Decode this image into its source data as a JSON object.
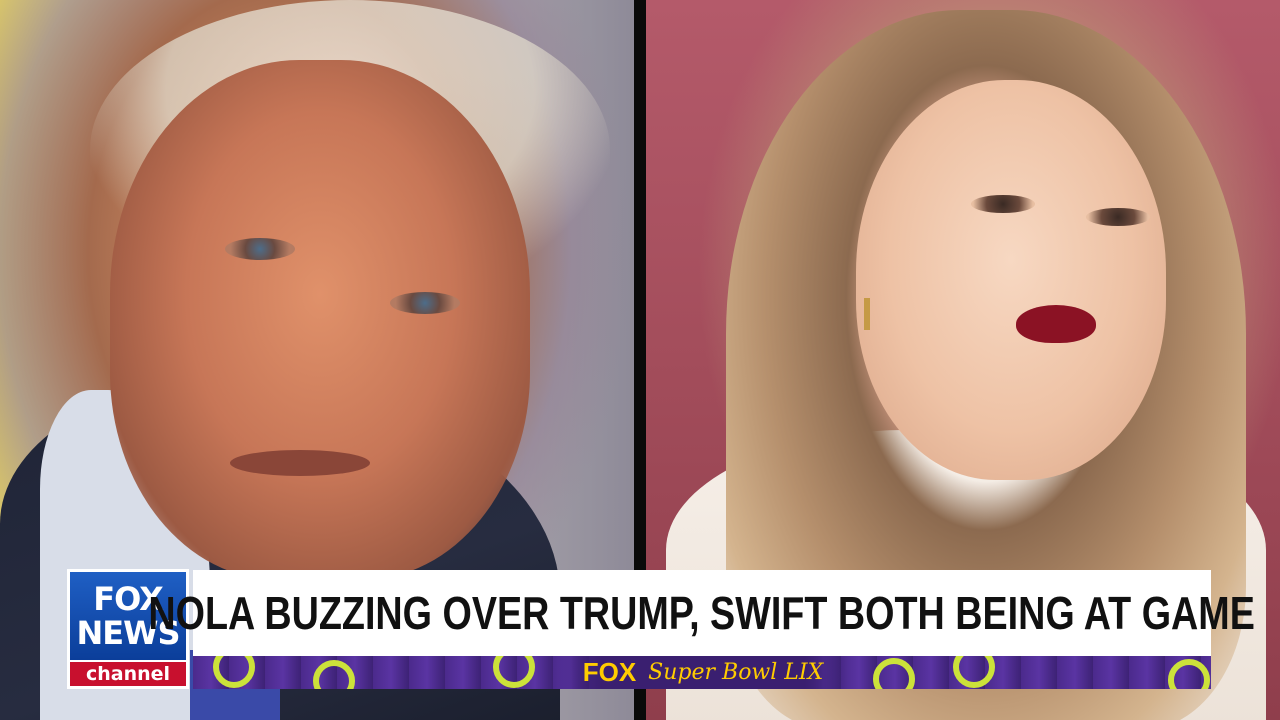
{
  "network": {
    "logo_lines": [
      "FOX",
      "NEWS"
    ],
    "logo_channel": "channel",
    "brand_blue": "#0b3e9a",
    "brand_red": "#c8102e"
  },
  "lower_third": {
    "headline": "NOLA BUZZING OVER TRUMP, SWIFT BOTH BEING AT GAME",
    "ticker_brand": "FOX",
    "ticker_event": "Super Bowl LIX",
    "ticker_colors": {
      "background": "#4b2a8c",
      "accent": "#cce23a",
      "text": "#ffcc00"
    }
  }
}
